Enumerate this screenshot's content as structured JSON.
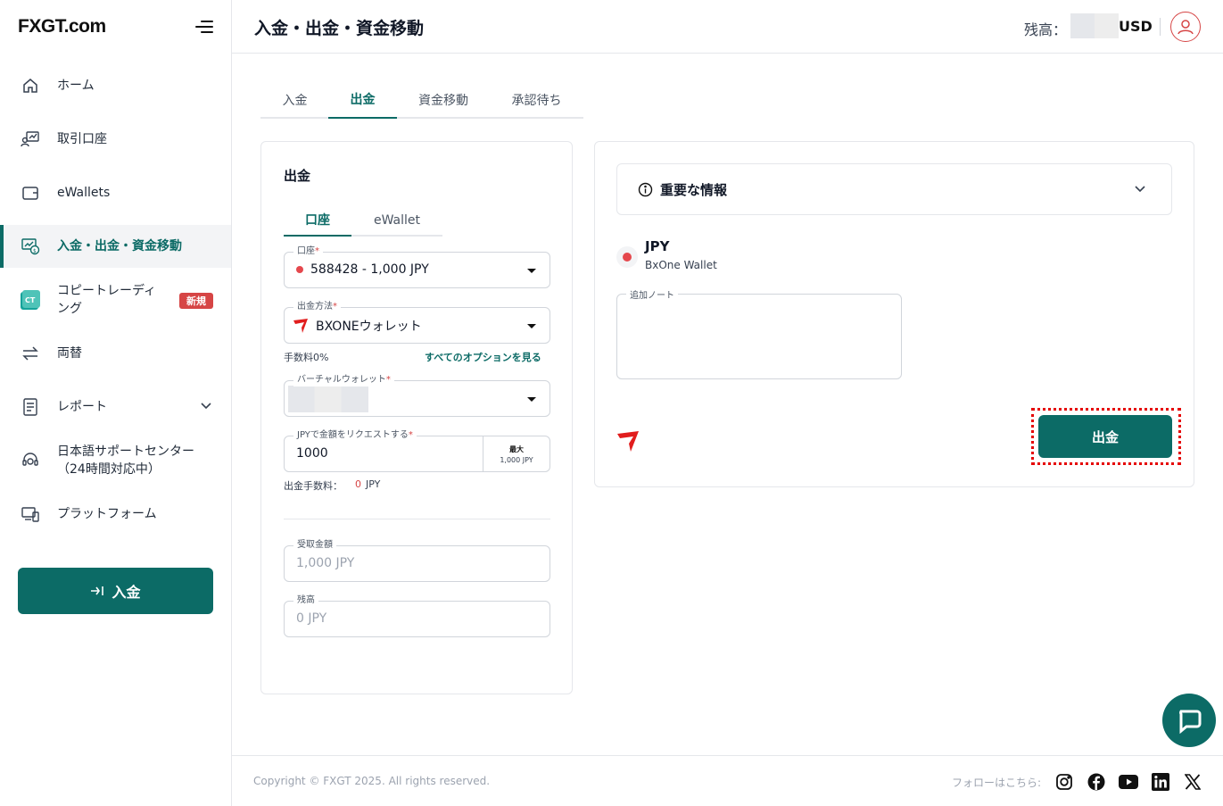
{
  "app": {
    "logo": "FXGT.com"
  },
  "sidebar": {
    "items": [
      {
        "label": "ホーム",
        "icon": "home-icon"
      },
      {
        "label": "取引口座",
        "icon": "trading-account-icon"
      },
      {
        "label": "eWallets",
        "icon": "wallet-icon"
      },
      {
        "label": "入金・出金・資金移動",
        "icon": "funds-transfer-icon"
      },
      {
        "label": "コピートレーディング",
        "icon": "copy-trading-icon",
        "badge": "新規",
        "line1": "コピートレーディ",
        "line2": "ング"
      },
      {
        "label": "両替",
        "icon": "exchange-icon"
      },
      {
        "label": "レポート",
        "icon": "report-icon"
      },
      {
        "label": "日本語サポートセンター（24時間対応中）",
        "icon": "support-icon",
        "line1": "日本語サポートセンター",
        "line2": "（24時間対応中）"
      },
      {
        "label": "プラットフォーム",
        "icon": "platform-icon"
      }
    ],
    "deposit_button": "入金"
  },
  "header": {
    "title": "入金・出金・資金移動",
    "balance_label": "残高：",
    "balance_currency": "USD"
  },
  "tabs": [
    "入金",
    "出金",
    "資金移動",
    "承認待ち"
  ],
  "withdraw_form": {
    "title": "出金",
    "subtabs": [
      "口座",
      "eWallet"
    ],
    "account": {
      "label": "口座",
      "value": "588428 - 1,000 JPY"
    },
    "method": {
      "label": "出金方法",
      "value": "BXONEウォレット"
    },
    "fee_rate": "手数料0%",
    "see_all": "すべてのオプションを見る",
    "virtual_wallet": {
      "label": "バーチャルウォレット"
    },
    "amount": {
      "label": "JPYで金額をリクエストする",
      "value": "1000",
      "max_label": "最大",
      "max_value": "1,000 JPY"
    },
    "withdraw_fee_label": "出金手数料：",
    "withdraw_fee_value": "0",
    "withdraw_fee_currency": "JPY",
    "received": {
      "label": "受取金額",
      "value": "1,000 JPY"
    },
    "remaining": {
      "label": "残高",
      "value": "0 JPY"
    }
  },
  "details": {
    "info_title": "重要な情報",
    "currency": "JPY",
    "wallet_name": "BxOne Wallet",
    "note_label": "追加ノート",
    "submit": "出金"
  },
  "footer": {
    "copyright": "Copyright © FXGT 2025. All rights reserved.",
    "follow": "フォローはこちら:",
    "social": [
      "instagram-icon",
      "facebook-icon",
      "youtube-icon",
      "linkedin-icon",
      "x-icon"
    ]
  },
  "colors": {
    "brand": "#0c6b66",
    "badge": "#d64545",
    "highlight": "#e50000"
  }
}
